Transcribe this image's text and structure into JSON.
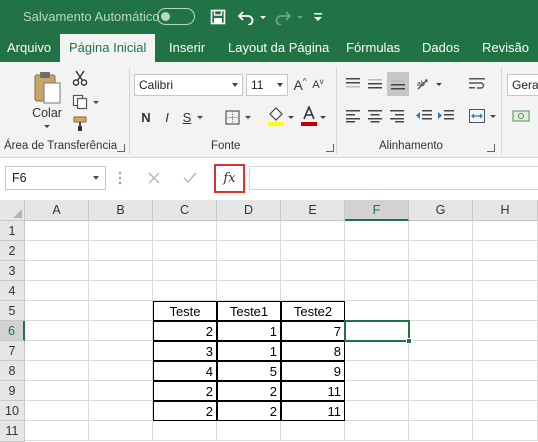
{
  "title_bar": {
    "autosave_label": "Salvamento Automático",
    "autosave_toggle_state": "off",
    "accent_color": "#217346"
  },
  "tabs": [
    {
      "label": "Arquivo",
      "active": false
    },
    {
      "label": "Página Inicial",
      "active": true
    },
    {
      "label": "Inserir",
      "active": false
    },
    {
      "label": "Layout da Página",
      "active": false
    },
    {
      "label": "Fórmulas",
      "active": false
    },
    {
      "label": "Dados",
      "active": false
    },
    {
      "label": "Revisão",
      "active": false
    }
  ],
  "ribbon": {
    "clipboard": {
      "paste_label": "Colar",
      "group_label": "Área de Transferência"
    },
    "font": {
      "font_name": "Calibri",
      "font_size": "11",
      "bold": "N",
      "italic": "I",
      "underline": "S",
      "group_label": "Fonte"
    },
    "alignment": {
      "group_label": "Alinhamento"
    },
    "number": {
      "format_partial": "Geral"
    }
  },
  "formula_bar": {
    "name_box": "F6",
    "fx_label": "fx",
    "formula_value": "",
    "highlight_color": "#e0302b"
  },
  "sheet": {
    "columns": [
      "A",
      "B",
      "C",
      "D",
      "E",
      "F",
      "G",
      "H"
    ],
    "selected_column": "F",
    "rows": [
      "1",
      "2",
      "3",
      "4",
      "5",
      "6",
      "7",
      "8",
      "9",
      "10",
      "11"
    ],
    "selected_row": "6",
    "selected_cell": "F6",
    "table": {
      "headers": [
        "Teste",
        "Teste1",
        "Teste2"
      ],
      "rows": [
        [
          "2",
          "1",
          "7"
        ],
        [
          "3",
          "1",
          "8"
        ],
        [
          "4",
          "5",
          "9"
        ],
        [
          "2",
          "2",
          "11"
        ],
        [
          "2",
          "2",
          "11"
        ]
      ]
    }
  }
}
